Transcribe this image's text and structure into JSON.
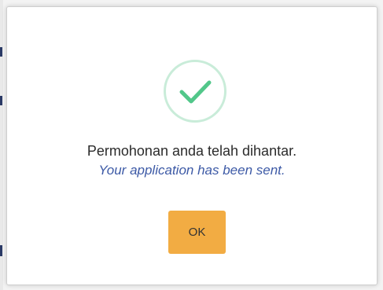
{
  "dialog": {
    "icon": "check-circle-icon",
    "icon_color": "#52c78a",
    "icon_ring_color": "#c9ecd9",
    "message_malay": "Permohonan anda telah dihantar.",
    "message_english": "Your application has been sent.",
    "english_text_color": "#3d5aa6",
    "ok_label": "OK",
    "ok_button_color": "#f2ac43"
  }
}
